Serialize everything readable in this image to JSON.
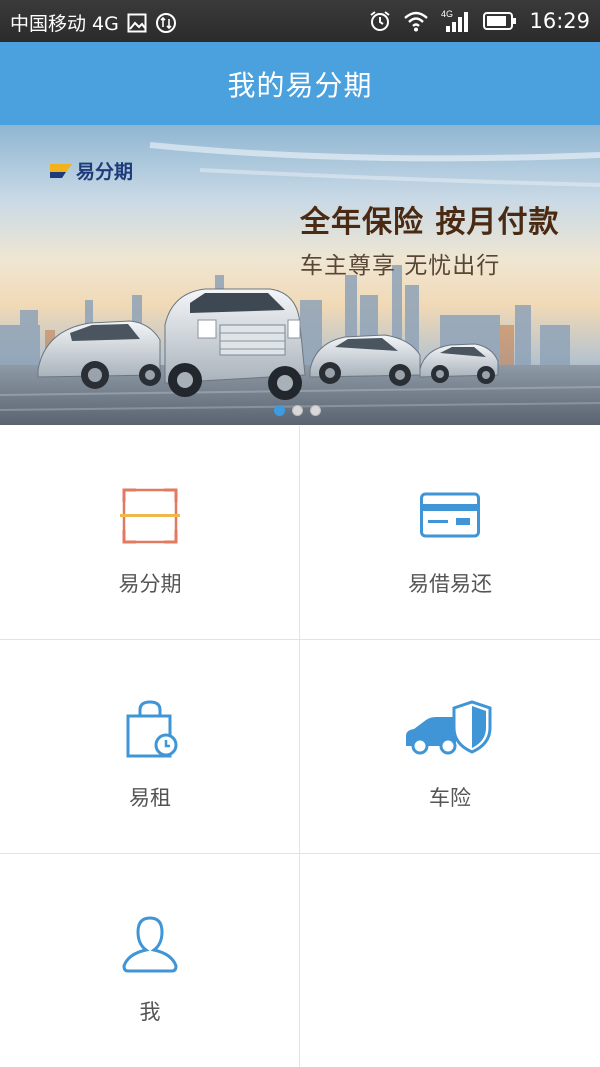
{
  "status_bar": {
    "carrier": "中国移动 4G",
    "network": "4G",
    "time": "16:29"
  },
  "header": {
    "title": "我的易分期"
  },
  "banner": {
    "logo_text": "易分期",
    "headline": "全年保险 按月付款",
    "subline": "车主尊享 无忧出行",
    "dot_count": 3,
    "active_dot": 0
  },
  "menu": {
    "items": [
      {
        "label": "易分期",
        "icon": "scan-frame-icon"
      },
      {
        "label": "易借易还",
        "icon": "credit-card-icon"
      },
      {
        "label": "易租",
        "icon": "shopping-bag-icon"
      },
      {
        "label": "车险",
        "icon": "car-shield-icon"
      },
      {
        "label": "我",
        "icon": "user-icon"
      }
    ]
  },
  "colors": {
    "header_bg": "#4aa1dd",
    "icon_blue": "#3f95d6",
    "icon_orange": "#e07b62",
    "label_gray": "#555555"
  }
}
